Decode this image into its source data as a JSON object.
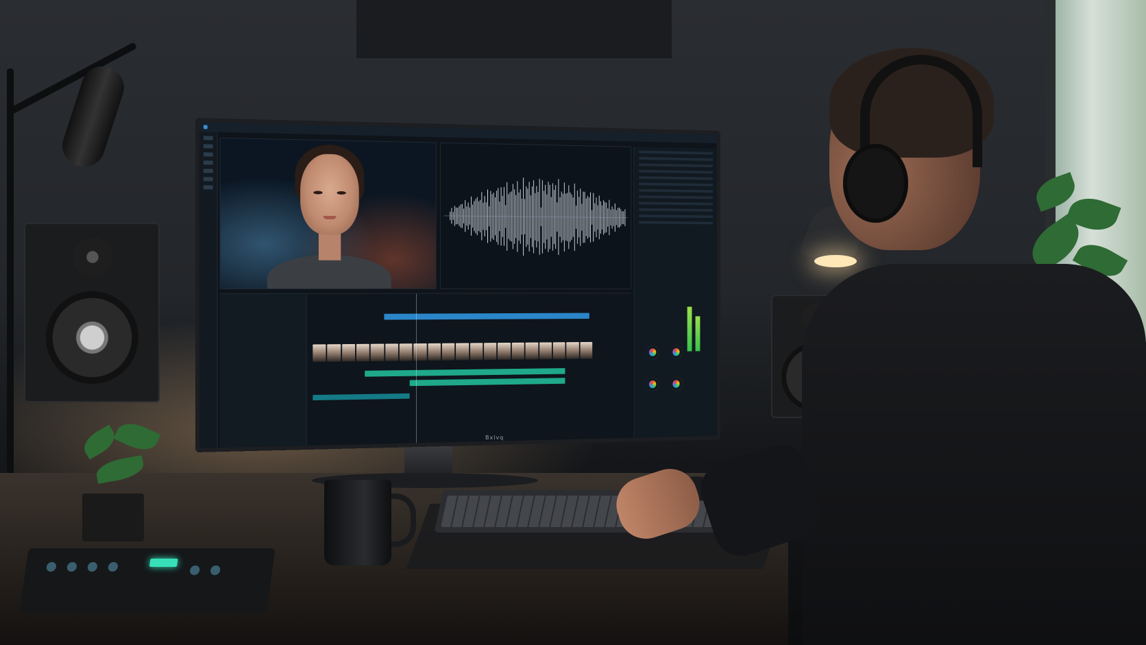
{
  "scene": {
    "monitor_brand": "Bxlvq",
    "colors": {
      "accent_blue": "#2a86c9",
      "accent_green": "#1fa98a",
      "meter_green": "#36c24b"
    }
  },
  "editor": {
    "icons": [
      "app-icon",
      "tool-icons",
      "color-wheel-icons"
    ]
  }
}
